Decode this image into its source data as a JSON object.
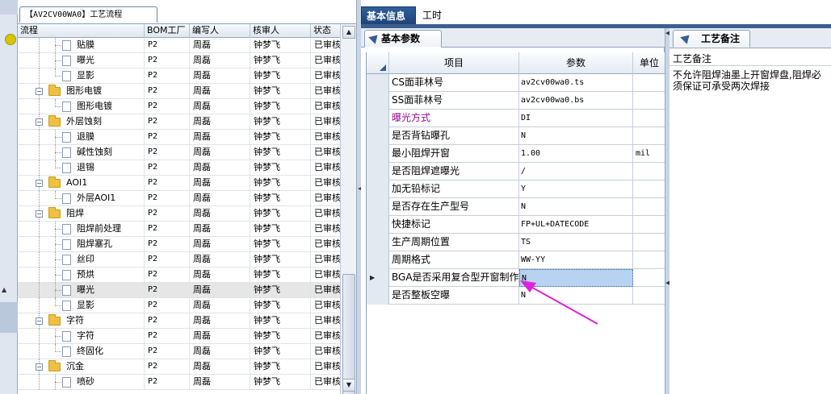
{
  "tree": {
    "window_tab": "【AV2CV00WA0】工艺流程",
    "columns": [
      "流程",
      "BOM工厂",
      "编写人",
      "核审人",
      "状态"
    ],
    "rows": [
      {
        "name": "贴膜",
        "bom": "P2",
        "writer": "周磊",
        "checker": "钟梦飞",
        "status": "已审核"
      },
      {
        "name": "曝光",
        "bom": "P2",
        "writer": "周磊",
        "checker": "钟梦飞",
        "status": "已审核"
      },
      {
        "name": "显影",
        "bom": "P2",
        "writer": "周磊",
        "checker": "钟梦飞",
        "status": "已审核"
      },
      {
        "name": "图形电镀",
        "bom": "P2",
        "writer": "周磊",
        "checker": "钟梦飞",
        "status": "已审核"
      },
      {
        "name": "图形电镀",
        "bom": "P2",
        "writer": "周磊",
        "checker": "钟梦飞",
        "status": "已审核"
      },
      {
        "name": "外层蚀刻",
        "bom": "P2",
        "writer": "周磊",
        "checker": "钟梦飞",
        "status": "已审核"
      },
      {
        "name": "退膜",
        "bom": "P2",
        "writer": "周磊",
        "checker": "钟梦飞",
        "status": "已审核"
      },
      {
        "name": "碱性蚀刻",
        "bom": "P2",
        "writer": "周磊",
        "checker": "钟梦飞",
        "status": "已审核"
      },
      {
        "name": "退锡",
        "bom": "P2",
        "writer": "周磊",
        "checker": "钟梦飞",
        "status": "已审核"
      },
      {
        "name": "AOI1",
        "bom": "P2",
        "writer": "周磊",
        "checker": "钟梦飞",
        "status": "已审核"
      },
      {
        "name": "外层AOI1",
        "bom": "P2",
        "writer": "周磊",
        "checker": "钟梦飞",
        "status": "已审核"
      },
      {
        "name": "阻焊",
        "bom": "P2",
        "writer": "周磊",
        "checker": "钟梦飞",
        "status": "已审核"
      },
      {
        "name": "阻焊前处理",
        "bom": "P2",
        "writer": "周磊",
        "checker": "钟梦飞",
        "status": "已审核"
      },
      {
        "name": "阻焊塞孔",
        "bom": "P2",
        "writer": "周磊",
        "checker": "钟梦飞",
        "status": "已审核"
      },
      {
        "name": "丝印",
        "bom": "P2",
        "writer": "周磊",
        "checker": "钟梦飞",
        "status": "已审核"
      },
      {
        "name": "预烘",
        "bom": "P2",
        "writer": "周磊",
        "checker": "钟梦飞",
        "status": "已审核"
      },
      {
        "name": "曝光",
        "bom": "P2",
        "writer": "周磊",
        "checker": "钟梦飞",
        "status": "已审核"
      },
      {
        "name": "显影",
        "bom": "P2",
        "writer": "周磊",
        "checker": "钟梦飞",
        "status": "已审核"
      },
      {
        "name": "字符",
        "bom": "P2",
        "writer": "周磊",
        "checker": "钟梦飞",
        "status": "已审核"
      },
      {
        "name": "字符",
        "bom": "P2",
        "writer": "周磊",
        "checker": "钟梦飞",
        "status": "已审核"
      },
      {
        "name": "终固化",
        "bom": "P2",
        "writer": "周磊",
        "checker": "钟梦飞",
        "status": "已审核"
      },
      {
        "name": "沉金",
        "bom": "P2",
        "writer": "周磊",
        "checker": "钟梦飞",
        "status": "已审核"
      },
      {
        "name": "喷砂",
        "bom": "P2",
        "writer": "周磊",
        "checker": "钟梦飞",
        "status": "已审核"
      }
    ]
  },
  "tabs": {
    "basic_info": "基本信息",
    "work_hours": "工时"
  },
  "params": {
    "panel_tab": "基本参数",
    "columns": [
      "项目",
      "参数",
      "单位"
    ],
    "rows": [
      {
        "item": "CS面菲林号",
        "value": "av2cv00wa0.ts",
        "unit": ""
      },
      {
        "item": "SS面菲林号",
        "value": "av2cv00wa0.bs",
        "unit": ""
      },
      {
        "item": "曝光方式",
        "value": "DI",
        "unit": ""
      },
      {
        "item": "是否背钻曝孔",
        "value": "N",
        "unit": ""
      },
      {
        "item": "最小阻焊开窗",
        "value": "1.00",
        "unit": "mil"
      },
      {
        "item": "是否阻焊遮曝光",
        "value": "/",
        "unit": ""
      },
      {
        "item": "加无铅标记",
        "value": "Y",
        "unit": ""
      },
      {
        "item": "是否存在生产型号",
        "value": "N",
        "unit": ""
      },
      {
        "item": "快捷标记",
        "value": "FP+UL+DATECODE",
        "unit": ""
      },
      {
        "item": "生产周期位置",
        "value": "TS",
        "unit": ""
      },
      {
        "item": "周期格式",
        "value": "WW-YY",
        "unit": ""
      },
      {
        "item": "BGA是否采用复合型开窗制作",
        "value": "N",
        "unit": ""
      },
      {
        "item": "是否整板空曝",
        "value": "N",
        "unit": ""
      }
    ]
  },
  "notes": {
    "panel_tab": "工艺备注",
    "header": "工艺备注",
    "text": "不允许阻焊油墨上开窗焊盘,阻焊必须保证可承受两次焊接"
  },
  "colors": {
    "accent": "#1d4478",
    "highlight_item": "#8b0f8e",
    "annotation_arrow": "#e020e0",
    "selected_cell": "#b8d3f2"
  }
}
